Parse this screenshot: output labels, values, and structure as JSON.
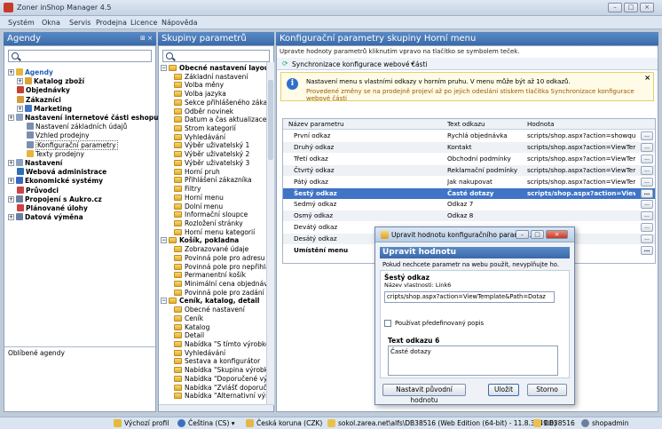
{
  "window": {
    "title": "Zoner inShop Manager 4.5"
  },
  "menu": [
    "Systém",
    "Okna",
    "Servis",
    "Prodejna",
    "Licence",
    "Nápověda"
  ],
  "agendy": {
    "header": "Agendy",
    "items": [
      {
        "label": "Agendy",
        "bold": true,
        "link": true
      },
      {
        "label": "Katalog zboží",
        "bold": true
      },
      {
        "label": "Objednávky",
        "bold": true
      },
      {
        "label": "Zákazníci",
        "bold": true
      },
      {
        "label": "Marketing",
        "bold": true
      },
      {
        "label": "Nastavení internetové části eshopu",
        "bold": true
      },
      {
        "label": "Nastavení základních údajů"
      },
      {
        "label": "Vzhled prodejny"
      },
      {
        "label": "Konfigurační parametry",
        "selected": true
      },
      {
        "label": "Texty prodejny"
      },
      {
        "label": "Nastavení",
        "bold": true
      },
      {
        "label": "Webová administrace",
        "bold": true
      },
      {
        "label": "Ekonomické systémy",
        "bold": true
      },
      {
        "label": "Průvodci",
        "bold": true
      },
      {
        "label": "Propojení s Aukro.cz",
        "bold": true
      },
      {
        "label": "Plánované úlohy",
        "bold": true
      },
      {
        "label": "Datová výměna",
        "bold": true
      }
    ],
    "favorites": "Oblíbené agendy"
  },
  "skupiny": {
    "header": "Skupiny parametrů",
    "items": [
      {
        "label": "Obecné nastavení layoutu",
        "group": true
      },
      {
        "label": "Základní nastavení"
      },
      {
        "label": "Volba měny"
      },
      {
        "label": "Volba jazyka"
      },
      {
        "label": "Sekce přihlášeného zákazník"
      },
      {
        "label": "Odběr novinek"
      },
      {
        "label": "Datum a čas aktualizace"
      },
      {
        "label": "Strom kategorií"
      },
      {
        "label": "Vyhledávání"
      },
      {
        "label": "Výběr uživatelský 1"
      },
      {
        "label": "Výběr uživatelský 2"
      },
      {
        "label": "Výběr uživatelský 3"
      },
      {
        "label": "Horní pruh"
      },
      {
        "label": "Přihlášení zákazníka"
      },
      {
        "label": "Filtry"
      },
      {
        "label": "Horní menu"
      },
      {
        "label": "Dolní menu"
      },
      {
        "label": "Informační sloupce"
      },
      {
        "label": "Rozložení stránky"
      },
      {
        "label": "Horní menu kategorií"
      },
      {
        "label": "Košík, pokladna",
        "group": true
      },
      {
        "label": "Zobrazované údaje"
      },
      {
        "label": "Povinná pole pro adresu zák"
      },
      {
        "label": "Povinná pole pro nepřihlášen"
      },
      {
        "label": "Permanentní košík"
      },
      {
        "label": "Minimální cena objednávky"
      },
      {
        "label": "Povinná pole pro zadání zvl"
      },
      {
        "label": "Ceník, katalog, detail",
        "group": true
      },
      {
        "label": "Obecné nastavení"
      },
      {
        "label": "Ceník"
      },
      {
        "label": "Katalog"
      },
      {
        "label": "Detail"
      },
      {
        "label": "Nabídka \"S tímto výrobkem s"
      },
      {
        "label": "Vyhledávání"
      },
      {
        "label": "Sestava a konfigurátor"
      },
      {
        "label": "Nabídka \"Skupina výrobků\""
      },
      {
        "label": "Nabídka \"Doporučené výrob"
      },
      {
        "label": "Nabídka \"Zvlášť doporučené"
      },
      {
        "label": "Nabídka \"Alternativní výrobl"
      }
    ]
  },
  "config": {
    "header": "Konfigurační parametry skupiny Horní menu",
    "subtitle": "Upravte hodnoty parametrů kliknutím vpravo na tlačítko se symbolem teček.",
    "sync_label": "Synchronizace konfigurace webové části",
    "info_line1": "Nastavení menu s vlastními odkazy v horním pruhu. V menu může být až 10 odkazů.",
    "info_line2": "Provedené změny se na prodejně projeví až po jejich odeslání stiskem tlačítka Synchronizace konfigurace webové části",
    "columns": [
      "Název parametru",
      "Text odkazu",
      "Hodnota"
    ],
    "rows": [
      {
        "name": "První odkaz",
        "text": "Rychlá objednávka",
        "value": "scripts/shop.aspx?action=showquick..."
      },
      {
        "name": "Druhý odkaz",
        "text": "Kontakt",
        "value": "scripts/shop.aspx?action=ViewTempl..."
      },
      {
        "name": "Třetí odkaz",
        "text": "Obchodní podmínky",
        "value": "scripts/shop.aspx?action=ViewTempl..."
      },
      {
        "name": "Čtvrtý odkaz",
        "text": "Reklamační podmínky",
        "value": "scripts/shop.aspx?action=ViewTempl..."
      },
      {
        "name": "Pátý odkaz",
        "text": "Jak nakupovat",
        "value": "scripts/shop.aspx?action=ViewTempl..."
      },
      {
        "name": "Šestý odkaz",
        "text": "Časté dotazy",
        "value": "scripts/shop.aspx?action=View...",
        "selected": true
      },
      {
        "name": "Sedmý odkaz",
        "text": "Odkaz 7",
        "value": ""
      },
      {
        "name": "Osmý odkaz",
        "text": "Odkaz 8",
        "value": ""
      },
      {
        "name": "Devátý odkaz",
        "text": "",
        "value": ""
      },
      {
        "name": "Desátý odkaz",
        "text": "",
        "value": ""
      },
      {
        "name": "Umístění menu",
        "text": "",
        "value": "",
        "bold": true
      }
    ],
    "more_btn": "..."
  },
  "dialog": {
    "window_title": "Upravit hodnotu konfiguračního paramet...",
    "heading": "Upravit hodnotu",
    "hint": "Pokud nechcete parametr na webu použít, nevyplňujte ho.",
    "param_name": "Šestý odkaz",
    "property": "Název vlastnosti: Link6",
    "value": "cripts/shop.aspx?action=ViewTemplate&Path=Dotaz",
    "checkbox_label": "Používat předefinovaný popis",
    "text_label": "Text odkazu 6",
    "text_value": "Časté dotazy",
    "btn_reset": "Nastavit původní hodnotu",
    "btn_save": "Uložit",
    "btn_cancel": "Storno"
  },
  "status": {
    "profile": "Výchozí profil",
    "language": "Čeština (CS)",
    "currency": "Česká koruna (CZK)",
    "db": "sokol.zarea.net\\alfs\\DB38516 (Web Edition (64-bit) - 11.8.3349.0)",
    "dbname": "DB38516",
    "user": "shopadmin"
  },
  "colors": {
    "accent": "#3a6aa8",
    "selection": "#3f74c6",
    "info": "#fffbe6"
  }
}
